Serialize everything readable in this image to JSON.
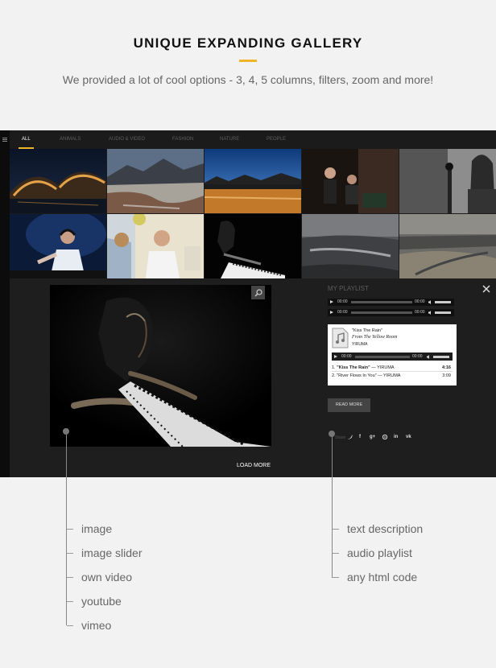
{
  "header": {
    "title": "UNIQUE EXPANDING GALLERY",
    "subtitle": "We provided a lot of cool options - 3, 4, 5 columns, filters, zoom and more!"
  },
  "gallery": {
    "filters": [
      "ALL",
      "ANIMALS",
      "AUDIO & VIDEO",
      "FASHION",
      "NATURE",
      "PEOPLE"
    ],
    "active_filter": "ALL",
    "load_more": "LOAD MORE"
  },
  "playlist": {
    "title": "MY PLAYLIST",
    "players": [
      {
        "current": "00:00",
        "total": "00:00"
      },
      {
        "current": "00:00",
        "total": "00:00"
      }
    ],
    "card": {
      "song_title": "\"Kiss The Rain\"",
      "album": "From The Yellow Room",
      "artist": "YIRUMA",
      "current": "00:00",
      "total": "00:00",
      "tracks": [
        {
          "num": "1.",
          "title": "\"Kiss The Rain\"",
          "artist": "— YIRUMA",
          "duration": "4:16"
        },
        {
          "num": "2.",
          "title": "\"River Flows In You\"",
          "artist": "— YIRUMA",
          "duration": "3:09"
        }
      ]
    },
    "read_more": "READ MORE",
    "share_label": "Share"
  },
  "features": {
    "left": [
      "image",
      "image slider",
      "own video",
      "youtube",
      "vimeo"
    ],
    "right": [
      "text description",
      "audio playlist",
      "any html code"
    ]
  },
  "colors": {
    "accent": "#f0b429",
    "gallery_bg": "#1b1b1b",
    "page_bg": "#f2f2f2"
  }
}
